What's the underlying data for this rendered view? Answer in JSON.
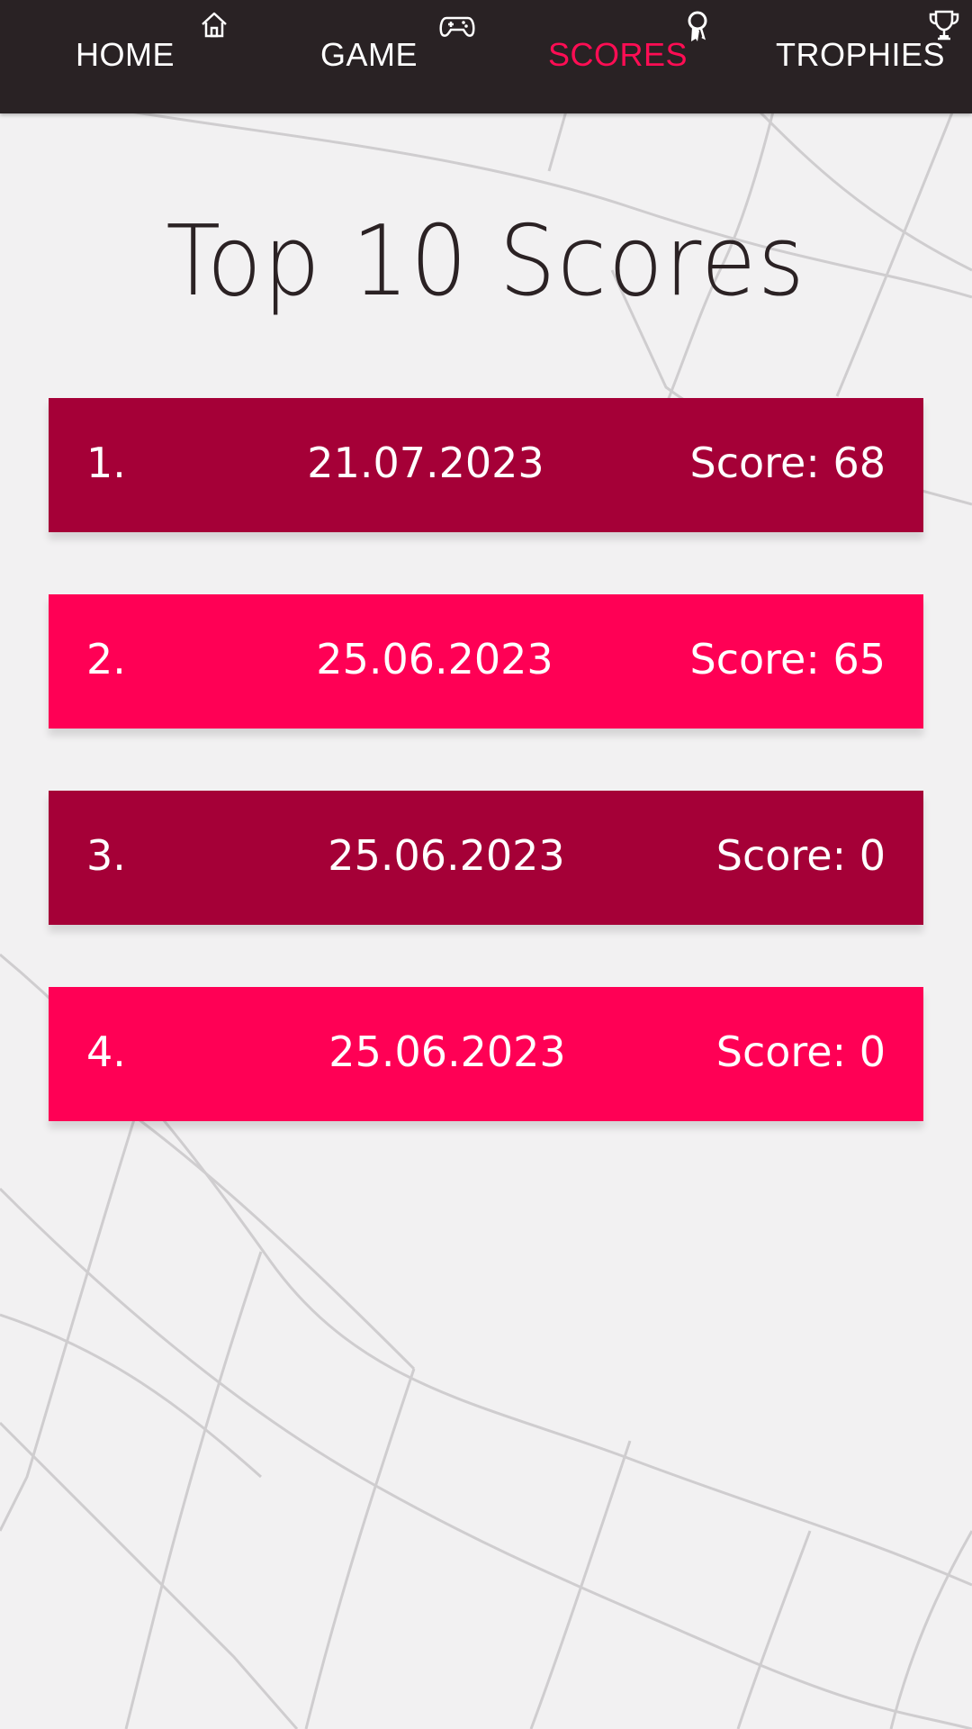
{
  "nav": {
    "items": [
      {
        "label": "HOME",
        "icon": "home-icon",
        "active": false
      },
      {
        "label": "GAME",
        "icon": "gamepad-icon",
        "active": false
      },
      {
        "label": "SCORES",
        "icon": "award-icon",
        "active": true
      },
      {
        "label": "TROPHIES",
        "icon": "trophy-icon",
        "active": false
      }
    ]
  },
  "page": {
    "title": "Top 10 Scores"
  },
  "scores": [
    {
      "rank": "1.",
      "date": "21.07.2023",
      "score": "Score: 68"
    },
    {
      "rank": "2.",
      "date": "25.06.2023",
      "score": "Score: 65"
    },
    {
      "rank": "3.",
      "date": "25.06.2023",
      "score": "Score: 0"
    },
    {
      "rank": "4.",
      "date": "25.06.2023",
      "score": "Score: 0"
    }
  ],
  "colors": {
    "nav_background": "#292224",
    "accent": "#ff0d54",
    "row_dark": "#a50037",
    "row_bright": "#ff0055",
    "background": "#f2f1f2"
  }
}
